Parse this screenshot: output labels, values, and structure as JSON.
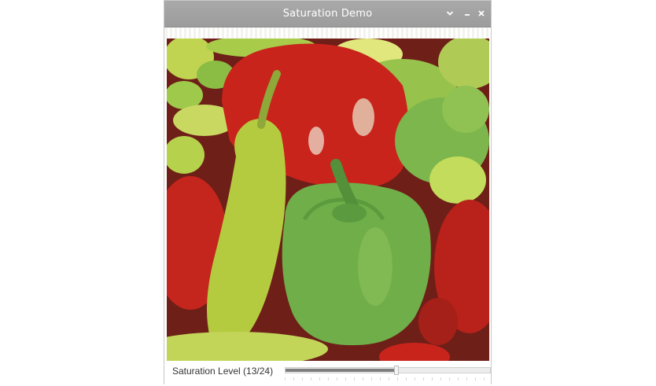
{
  "window": {
    "title": "Saturation Demo",
    "buttons": {
      "dropdown_icon": "chevron-down-icon",
      "minimize_icon": "minimize-icon",
      "close_icon": "close-icon"
    }
  },
  "image": {
    "subject": "peppers photo",
    "colors": {
      "red_pepper": "#c8241c",
      "green_pepper": "#74b24a",
      "yellow_green_pepper": "#b7cf43",
      "dark_background": "#6e1f18"
    }
  },
  "control": {
    "label": "Saturation Level (13/24)",
    "value": 13,
    "max": 24,
    "fraction": 0.5417
  },
  "colors": {
    "titlebar": "#a4a4a4",
    "slider_fill": "#7e7e7e"
  }
}
